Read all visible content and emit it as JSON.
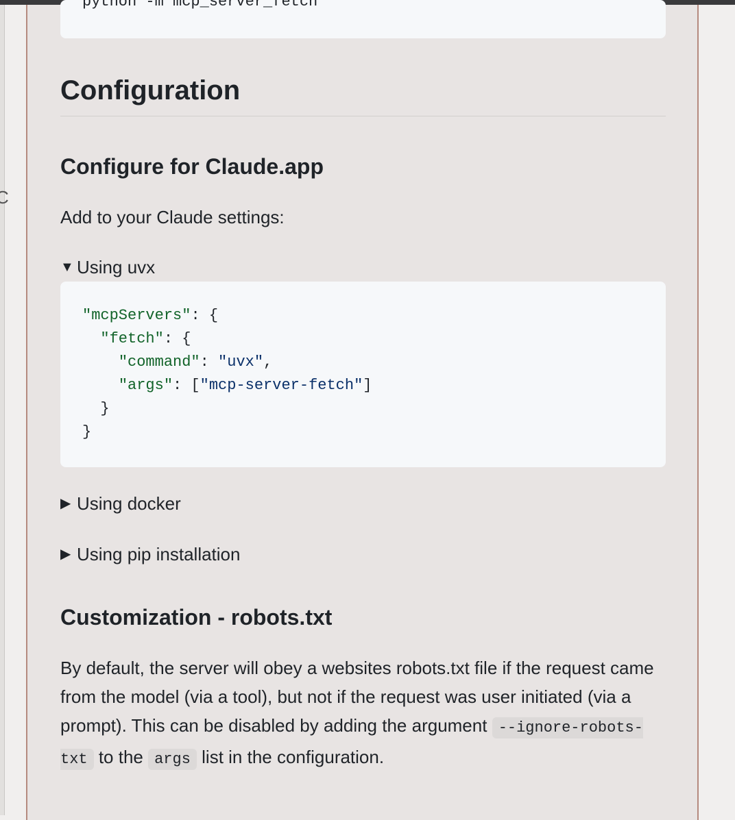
{
  "top_code": "python -m mcp_server_fetch",
  "section_title": "Configuration",
  "subsection_claude": "Configure for Claude.app",
  "intro_text": "Add to your Claude settings:",
  "details": [
    {
      "label": "Using uvx",
      "open": true
    },
    {
      "label": "Using docker",
      "open": false
    },
    {
      "label": "Using pip installation",
      "open": false
    }
  ],
  "uvx_code": {
    "key_mcp": "\"mcpServers\"",
    "key_fetch": "\"fetch\"",
    "key_command": "\"command\"",
    "val_command": "\"uvx\"",
    "key_args": "\"args\"",
    "val_args": "\"mcp-server-fetch\""
  },
  "subsection_custom": "Customization - robots.txt",
  "custom_text": {
    "part1": "By default, the server will obey a websites robots.txt file if the request came from the model (via a tool), but not if the request was user initiated (via a prompt). This can be disabled by adding the argument ",
    "code1": "--ignore-robots-txt",
    "part2": " to the ",
    "code2": "args",
    "part3": " list in the configuration."
  }
}
